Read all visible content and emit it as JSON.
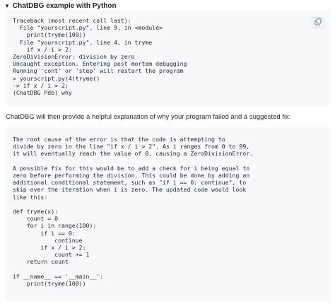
{
  "details": {
    "summary_marker": "▼",
    "summary_title": "ChatDBG example with Python"
  },
  "traceback": {
    "code": "Traceback (most recent call last):\n  File \"yourscript.py\", line 9, in <module>\n    print(tryme(100))\n  File \"yourscript.py\", line 4, in tryme\n    if x / i > 2:\nZeroDivisionError: division by zero\nUncaught exception. Entering post mortem debugging\nRunning 'cont' or 'step' will restart the program\n> yourscript.py(4)tryme()\n-> if x / i > 2:\n(ChatDBG Pdb) why"
  },
  "copy_button": {
    "icon": "copy-icon"
  },
  "explanation_intro": "ChatDBG will then provide a helpful explanation of why your program failed and a suggested fix:",
  "explanation": {
    "code": "The root cause of the error is that the code is attempting to\ndivide by zero in the line \"if x / i > 2\". As i ranges from 0 to 99,\nit will eventually reach the value of 0, causing a ZeroDivisionError.\n\nA possible fix for this would be to add a check for i being equal to\nzero before performing the division. This could be done by adding an\nadditional conditional statement, such as \"if i == 0: continue\", to\nskip over the iteration when i is zero. The updated code would look\nlike this:\n\ndef tryme(x):\n    count = 0\n    for i in range(100):\n        if i == 0:\n            continue\n        if x / i > 2:\n            count += 1\n    return count\n\nif __name__ == '__main__':\n    print(tryme(100))"
  }
}
